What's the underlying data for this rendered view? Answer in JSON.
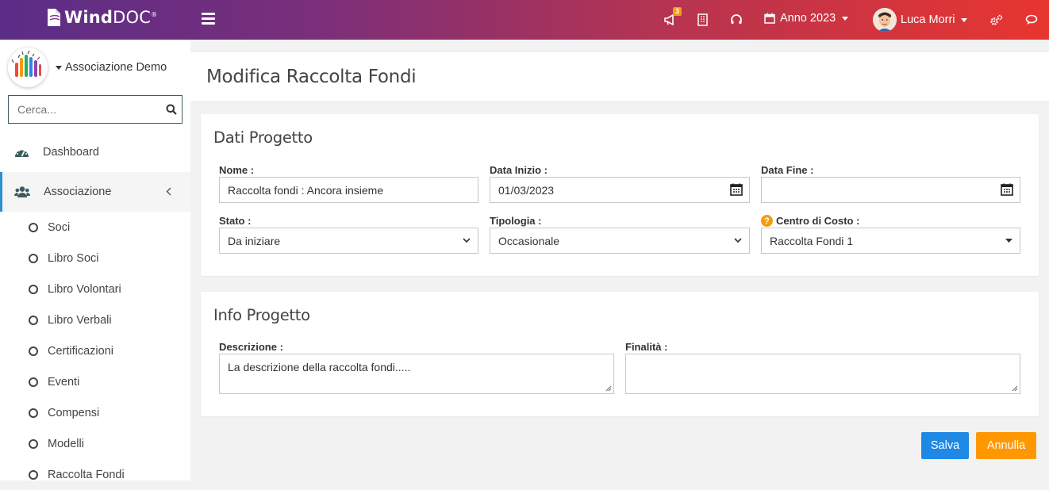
{
  "app": {
    "logo_bold": "Wind",
    "logo_light": "DOC",
    "logo_reg": "®"
  },
  "header": {
    "notification_count": "3",
    "year_label": "Anno 2023",
    "user_name": "Luca Morri"
  },
  "sidebar": {
    "org_name": "Associazione Demo",
    "search_placeholder": "Cerca...",
    "dashboard_label": "Dashboard",
    "association_label": "Associazione",
    "sub_items": [
      {
        "label": "Soci"
      },
      {
        "label": "Libro Soci"
      },
      {
        "label": "Libro Volontari"
      },
      {
        "label": "Libro Verbali"
      },
      {
        "label": "Certificazioni"
      },
      {
        "label": "Eventi"
      },
      {
        "label": "Compensi"
      },
      {
        "label": "Modelli"
      },
      {
        "label": "Raccolta Fondi"
      }
    ]
  },
  "page": {
    "title": "Modifica Raccolta Fondi"
  },
  "dati_progetto": {
    "title": "Dati Progetto",
    "nome_label": "Nome :",
    "nome_value": "Raccolta fondi : Ancora insieme",
    "data_inizio_label": "Data Inizio :",
    "data_inizio_value": "01/03/2023",
    "data_fine_label": "Data Fine :",
    "data_fine_value": "",
    "stato_label": "Stato :",
    "stato_value": "Da iniziare",
    "tipologia_label": "Tipologia :",
    "tipologia_value": "Occasionale",
    "centro_label": "Centro di Costo :",
    "centro_value": "Raccolta Fondi 1"
  },
  "info_progetto": {
    "title": "Info Progetto",
    "descrizione_label": "Descrizione :",
    "descrizione_value": "La descrizione della raccolta fondi.....",
    "finalita_label": "Finalità :",
    "finalita_value": ""
  },
  "actions": {
    "save_label": "Salva",
    "cancel_label": "Annulla"
  },
  "colors": {
    "save": "#1e88e5",
    "cancel": "#ff9800",
    "active_border": "#2b8fd0",
    "badge": "#f39c12"
  }
}
